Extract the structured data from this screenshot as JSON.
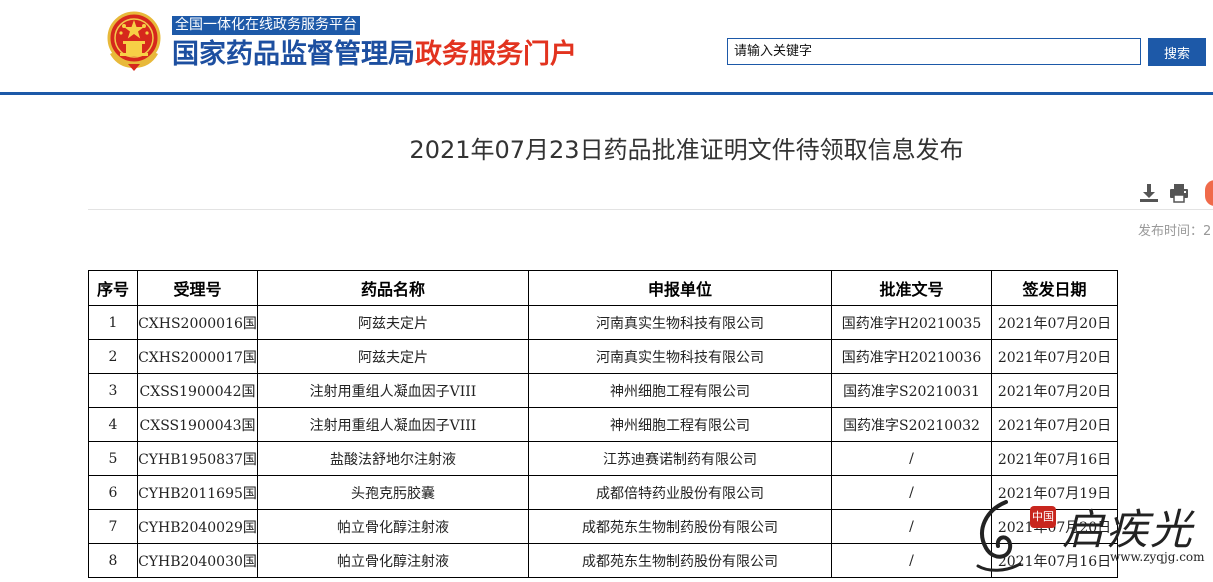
{
  "header": {
    "subtitle": "全国一体化在线政务服务平台",
    "title_part1": "国家药品监督管理局",
    "title_part2": "政务服务门户",
    "search_placeholder": "请输入关键字",
    "search_button": "搜索",
    "brand_blue": "#1d59a8",
    "brand_red": "#e2331f"
  },
  "article": {
    "title": "2021年07月23日药品批准证明文件待领取信息发布",
    "publish_label": "发布时间：2",
    "tools": [
      "download-icon",
      "print-icon",
      "share-icon"
    ]
  },
  "table": {
    "headers": [
      "序号",
      "受理号",
      "药品名称",
      "申报单位",
      "批准文号",
      "签发日期"
    ],
    "rows": [
      [
        "1",
        "CXHS2000016国",
        "阿兹夫定片",
        "河南真实生物科技有限公司",
        "国药准字H20210035",
        "2021年07月20日"
      ],
      [
        "2",
        "CXHS2000017国",
        "阿兹夫定片",
        "河南真实生物科技有限公司",
        "国药准字H20210036",
        "2021年07月20日"
      ],
      [
        "3",
        "CXSS1900042国",
        "注射用重组人凝血因子VIII",
        "神州细胞工程有限公司",
        "国药准字S20210031",
        "2021年07月20日"
      ],
      [
        "4",
        "CXSS1900043国",
        "注射用重组人凝血因子VIII",
        "神州细胞工程有限公司",
        "国药准字S20210032",
        "2021年07月20日"
      ],
      [
        "5",
        "CYHB1950837国",
        "盐酸法舒地尔注射液",
        "江苏迪赛诺制药有限公司",
        "/",
        "2021年07月16日"
      ],
      [
        "6",
        "CYHB2011695国",
        "头孢克肟胶囊",
        "成都倍特药业股份有限公司",
        "/",
        "2021年07月19日"
      ],
      [
        "7",
        "CYHB2040029国",
        "帕立骨化醇注射液",
        "成都苑东生物制药股份有限公司",
        "/",
        "2021年07月20日"
      ],
      [
        "8",
        "CYHB2040030国",
        "帕立骨化醇注射液",
        "成都苑东生物制药股份有限公司",
        "/",
        "2021年07月16日"
      ]
    ]
  },
  "watermark": {
    "brand": "启疾光",
    "seal": "中国",
    "url": "www.zyqjg.com"
  }
}
